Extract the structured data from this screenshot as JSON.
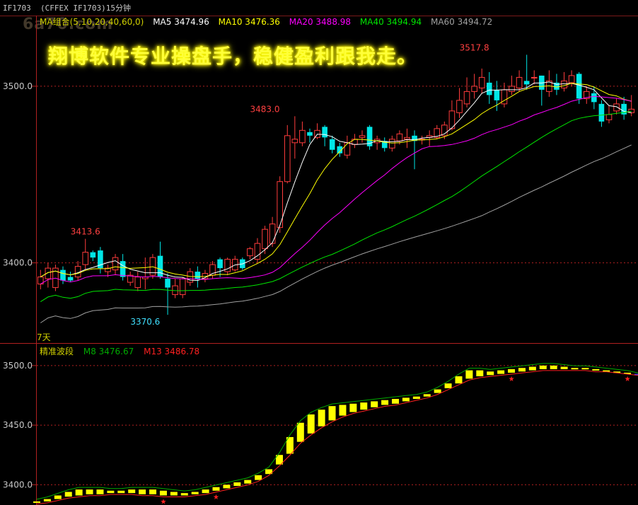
{
  "header": {
    "title": "IF1703  (CFFEX IF1703)15分钟",
    "watermark": "6a70.com"
  },
  "banner": {
    "text": "翔博软件专业操盘手，稳健盈利跟我走。"
  },
  "ma_legend": {
    "group": "MA组合(5,10,20,40,60,0)",
    "ma5": "MA5 3474.96",
    "ma10": "MA10 3476.36",
    "ma20": "MA20 3488.98",
    "ma40": "MA40 3494.94",
    "ma60": "MA60 3494.72"
  },
  "indicator_legend": {
    "name": "精准波段",
    "m8": "M8   3476.67",
    "m13": "M13   3486.78"
  },
  "colors": {
    "up": "#ff3c3c",
    "down": "#00e6e6",
    "ma5": "#ffffff",
    "ma10": "#ffff00",
    "ma20": "#ff00ff",
    "ma40": "#00e600",
    "ma60": "#a0a0a0",
    "grid": "#b02020",
    "m8": "#00aa00",
    "m13": "#ff2020",
    "band": "#ffff00"
  },
  "chart_data": [
    {
      "type": "candlestick",
      "title": "IF1703 15分钟",
      "y_ticks": [
        3400.0,
        3500.0
      ],
      "y_tick_labels": [
        "3400.0",
        "3500.0"
      ],
      "ylim": [
        3355,
        3540
      ],
      "period_label": "7天",
      "annotations": [
        {
          "label": "3413.6",
          "bar": 6,
          "price": 3413.6
        },
        {
          "label": "3370.6",
          "bar": 14,
          "price": 3370.6
        },
        {
          "label": "3483.0",
          "bar": 30,
          "price": 3483.0
        },
        {
          "label": "3517.8",
          "bar": 58,
          "price": 3517.8
        }
      ],
      "candles": [
        [
          3388,
          3392,
          3396,
          3385
        ],
        [
          3391,
          3397,
          3400,
          3386
        ],
        [
          3386,
          3397,
          3399,
          3384
        ],
        [
          3396,
          3390,
          3398,
          3388
        ],
        [
          3392,
          3390,
          3395,
          3389
        ],
        [
          3392,
          3398,
          3401,
          3390
        ],
        [
          3399,
          3406,
          3413.6,
          3396
        ],
        [
          3406,
          3403,
          3407,
          3401
        ],
        [
          3407,
          3397,
          3409,
          3394
        ],
        [
          3395,
          3397,
          3399,
          3392
        ],
        [
          3396,
          3403,
          3405,
          3393
        ],
        [
          3401,
          3392,
          3405,
          3390
        ],
        [
          3389,
          3393,
          3395,
          3387
        ],
        [
          3386,
          3392,
          3395,
          3384
        ],
        [
          3391,
          3392,
          3403,
          3385
        ],
        [
          3393,
          3403,
          3405,
          3391
        ],
        [
          3404,
          3392,
          3412,
          3391
        ],
        [
          3391,
          3386,
          3394,
          3370.6
        ],
        [
          3382,
          3387,
          3391,
          3380
        ],
        [
          3382,
          3391,
          3392,
          3380
        ],
        [
          3389,
          3395,
          3397,
          3387
        ],
        [
          3395,
          3391,
          3398,
          3386
        ],
        [
          3391,
          3394,
          3396,
          3389
        ],
        [
          3393,
          3399,
          3401,
          3391
        ],
        [
          3402,
          3397,
          3403,
          3392
        ],
        [
          3395,
          3402,
          3403,
          3393
        ],
        [
          3396,
          3402,
          3404,
          3395
        ],
        [
          3402,
          3397,
          3403,
          3396
        ],
        [
          3404,
          3408,
          3409,
          3402
        ],
        [
          3402,
          3411,
          3414,
          3400
        ],
        [
          3408,
          3419,
          3421,
          3405
        ],
        [
          3411,
          3422,
          3426,
          3409
        ],
        [
          3420,
          3446,
          3449,
          3417
        ],
        [
          3446,
          3472,
          3478,
          3445
        ],
        [
          3468,
          3470,
          3483.0,
          3459
        ],
        [
          3468,
          3475,
          3480,
          3466
        ],
        [
          3474,
          3472,
          3476,
          3468
        ],
        [
          3471,
          3475,
          3479,
          3470
        ],
        [
          3477,
          3471,
          3478,
          3466
        ],
        [
          3470,
          3464,
          3472,
          3462
        ],
        [
          3466,
          3462,
          3468,
          3460
        ],
        [
          3461,
          3468,
          3472,
          3459
        ],
        [
          3467,
          3470,
          3473,
          3465
        ],
        [
          3471,
          3472,
          3475,
          3468
        ],
        [
          3477,
          3466,
          3478,
          3464
        ],
        [
          3468,
          3470,
          3472,
          3464
        ],
        [
          3469,
          3465,
          3471,
          3463
        ],
        [
          3465,
          3470,
          3472,
          3463
        ],
        [
          3469,
          3473,
          3475,
          3467
        ],
        [
          3470,
          3471,
          3476,
          3465
        ],
        [
          3472,
          3469,
          3475,
          3453
        ],
        [
          3470,
          3470,
          3472,
          3467
        ],
        [
          3471,
          3472,
          3475,
          3466
        ],
        [
          3471,
          3476,
          3478,
          3470
        ],
        [
          3472,
          3478,
          3480,
          3470
        ],
        [
          3476,
          3486,
          3492,
          3475
        ],
        [
          3485,
          3492,
          3499,
          3482
        ],
        [
          3490,
          3497,
          3505,
          3488
        ],
        [
          3497,
          3500,
          3507,
          3493
        ],
        [
          3499,
          3505,
          3510,
          3496
        ],
        [
          3502,
          3495,
          3508,
          3490
        ],
        [
          3498,
          3492,
          3503,
          3486
        ],
        [
          3490,
          3498,
          3502,
          3488
        ],
        [
          3497,
          3500,
          3506,
          3495
        ],
        [
          3499,
          3505,
          3509,
          3497
        ],
        [
          3503,
          3501,
          3517.8,
          3498
        ],
        [
          3505,
          3505,
          3509,
          3501
        ],
        [
          3506,
          3498,
          3506,
          3489
        ],
        [
          3497,
          3503,
          3509,
          3494
        ],
        [
          3502,
          3498,
          3507,
          3495
        ],
        [
          3499,
          3503,
          3508,
          3497
        ],
        [
          3502,
          3506,
          3509,
          3500
        ],
        [
          3507,
          3493,
          3508,
          3490
        ],
        [
          3493,
          3497,
          3500,
          3490
        ],
        [
          3496,
          3491,
          3500,
          3487
        ],
        [
          3490,
          3480,
          3492,
          3477
        ],
        [
          3481,
          3484,
          3489,
          3479
        ],
        [
          3486,
          3490,
          3493,
          3484
        ],
        [
          3490,
          3484,
          3494,
          3481
        ],
        [
          3485,
          3487,
          3495,
          3483
        ]
      ],
      "series": [
        {
          "name": "MA5"
        },
        {
          "name": "MA10"
        },
        {
          "name": "MA20"
        },
        {
          "name": "MA40"
        },
        {
          "name": "MA60"
        }
      ]
    },
    {
      "type": "line",
      "title": "精准波段",
      "y_ticks": [
        3400.0,
        3450.0,
        3500.0
      ],
      "y_tick_labels": [
        "3400.0",
        "3450.0",
        "3500.0"
      ],
      "ylim": [
        3383,
        3510
      ],
      "series": [
        {
          "name": "M8",
          "values": [
            3386,
            3388,
            3391,
            3394,
            3396,
            3396,
            3396,
            3395,
            3395,
            3396,
            3396,
            3396,
            3395,
            3394,
            3393,
            3394,
            3396,
            3398,
            3400,
            3402,
            3404,
            3408,
            3413,
            3425,
            3440,
            3452,
            3459,
            3463,
            3466,
            3467,
            3468,
            3469,
            3470,
            3471,
            3472,
            3473,
            3474,
            3476,
            3480,
            3485,
            3491,
            3496,
            3496,
            3495,
            3496,
            3497,
            3498,
            3499,
            3500,
            3500,
            3499,
            3498,
            3498,
            3497,
            3496,
            3495,
            3494,
            3492
          ]
        },
        {
          "name": "M13",
          "values": [
            3385,
            3386,
            3388,
            3390,
            3391,
            3392,
            3392,
            3393,
            3393,
            3393,
            3392,
            3392,
            3391,
            3391,
            3391,
            3392,
            3393,
            3395,
            3397,
            3399,
            3401,
            3404,
            3409,
            3417,
            3426,
            3436,
            3443,
            3449,
            3454,
            3458,
            3461,
            3463,
            3465,
            3467,
            3468,
            3470,
            3472,
            3474,
            3477,
            3481,
            3485,
            3489,
            3491,
            3492,
            3493,
            3494,
            3495,
            3496,
            3497,
            3497,
            3497,
            3497,
            3497,
            3496,
            3496,
            3495,
            3494,
            3493
          ]
        }
      ],
      "markers_at": [
        12,
        17,
        45,
        56
      ]
    }
  ]
}
